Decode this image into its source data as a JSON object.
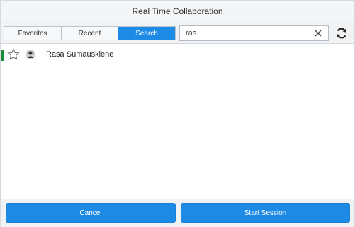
{
  "window": {
    "title": "Real Time Collaboration"
  },
  "tabs": [
    {
      "label": "Favorites",
      "active": false
    },
    {
      "label": "Recent",
      "active": false
    },
    {
      "label": "Search",
      "active": true
    }
  ],
  "search": {
    "value": "ras",
    "clear_icon": "close-icon"
  },
  "refresh": {
    "icon": "refresh-icon"
  },
  "results": [
    {
      "name": "Rasa Sumauskiene",
      "presence_color": "#1e8a3a",
      "favorite": false,
      "icon": "user-avatar-icon"
    }
  ],
  "footer": {
    "cancel_label": "Cancel",
    "start_label": "Start Session"
  },
  "colors": {
    "accent": "#1d8ae6",
    "presence_online": "#1e8a3a",
    "toolbar_bg": "#f0f2f4"
  }
}
